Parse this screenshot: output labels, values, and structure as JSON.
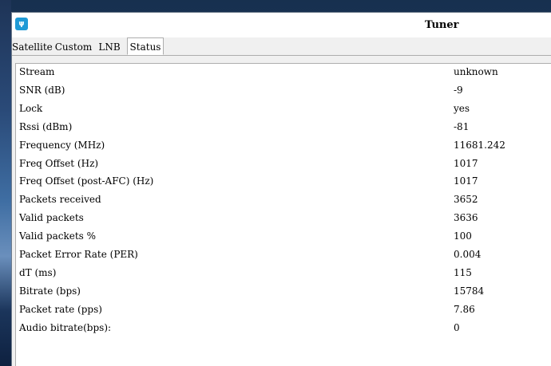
{
  "window": {
    "title": "Tuner",
    "icon": "tuner-app-icon"
  },
  "tabs": [
    {
      "label": "Satellite",
      "active": false
    },
    {
      "label": "Custom",
      "active": false
    },
    {
      "label": "LNB",
      "active": false
    },
    {
      "label": "Status",
      "active": true
    }
  ],
  "status": {
    "rows": [
      {
        "label": "Stream",
        "value": "unknown"
      },
      {
        "label": "SNR (dB)",
        "value": "-9"
      },
      {
        "label": "Lock",
        "value": "yes"
      },
      {
        "label": "Rssi (dBm)",
        "value": "-81"
      },
      {
        "label": "Frequency (MHz)",
        "value": "11681.242"
      },
      {
        "label": "Freq Offset (Hz)",
        "value": "1017"
      },
      {
        "label": "Freq Offset (post-AFC) (Hz)",
        "value": "1017"
      },
      {
        "label": "Packets received",
        "value": "3652"
      },
      {
        "label": "Valid packets",
        "value": "3636"
      },
      {
        "label": "Valid packets %",
        "value": "100"
      },
      {
        "label": "Packet Error Rate (PER)",
        "value": "0.004"
      },
      {
        "label": "dT (ms)",
        "value": "115"
      },
      {
        "label": "Bitrate (bps)",
        "value": "15784"
      },
      {
        "label": "Packet rate (pps)",
        "value": "7.86"
      },
      {
        "label": "Audio bitrate(bps):",
        "value": "0"
      }
    ]
  }
}
